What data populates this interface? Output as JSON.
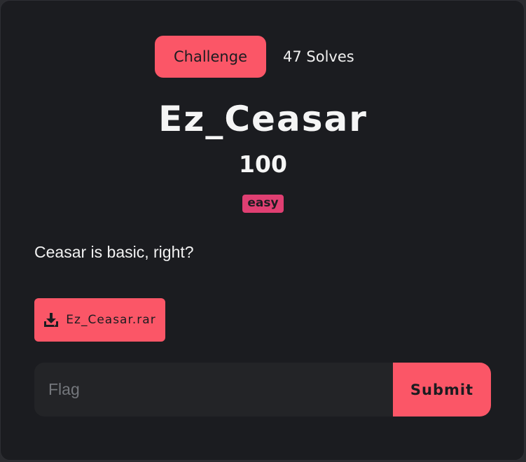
{
  "tabs": {
    "challenge_label": "Challenge",
    "solves_label": "47 Solves"
  },
  "challenge": {
    "name": "Ez_Ceasar",
    "points": "100",
    "difficulty_tag": "easy",
    "description": "Ceasar is basic, right?"
  },
  "file": {
    "name": "Ez_Ceasar.rar",
    "icon": "download-icon"
  },
  "flag_form": {
    "placeholder": "Flag",
    "value": "",
    "submit_label": "Submit"
  },
  "colors": {
    "accent": "#fb5667",
    "tag": "#e03f72",
    "background": "#1b1c20",
    "input": "#232427"
  }
}
